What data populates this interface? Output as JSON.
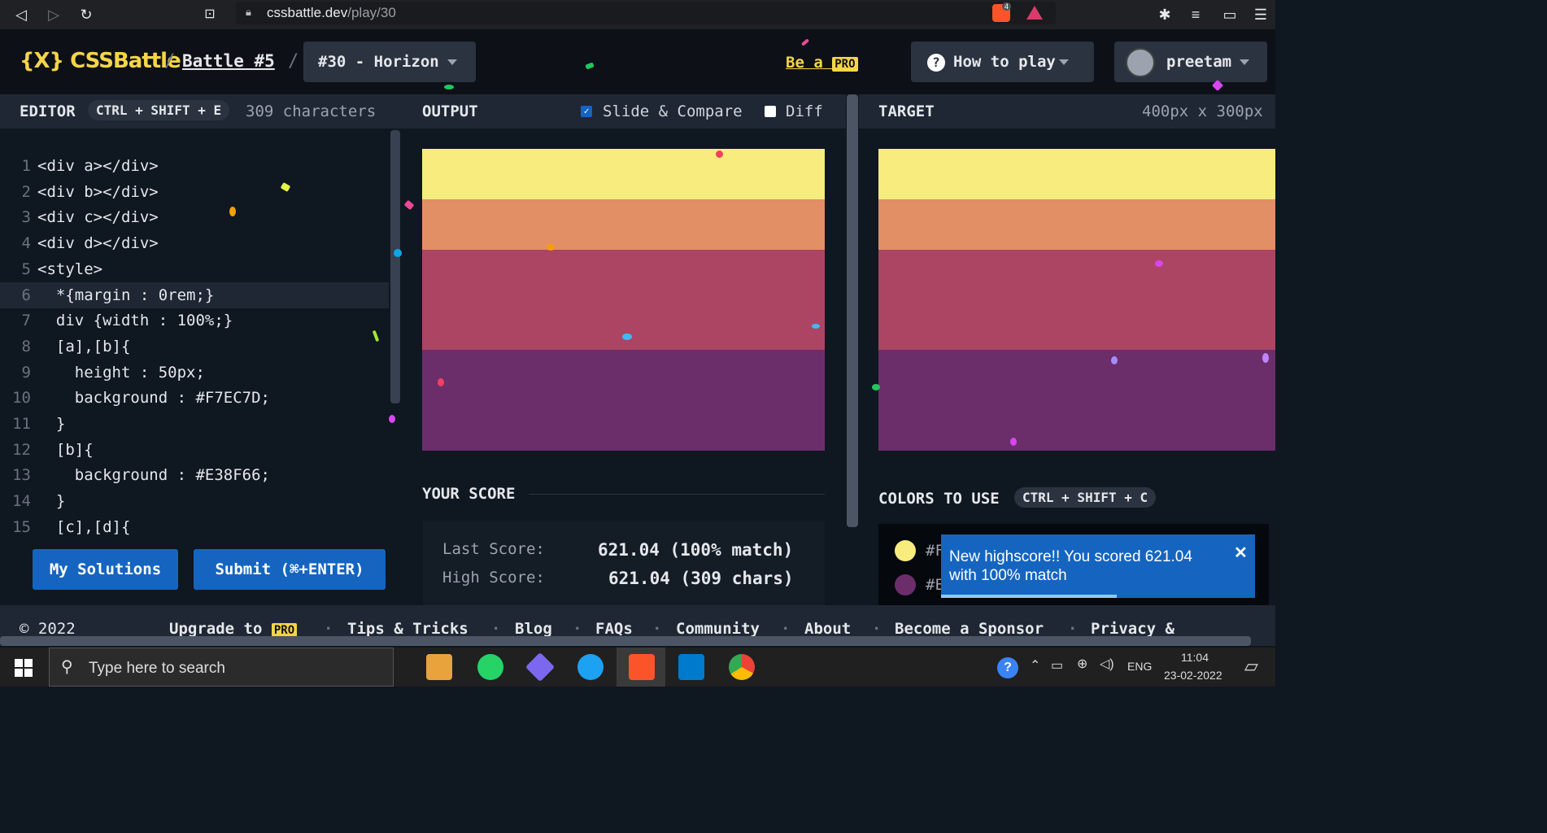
{
  "browser": {
    "url_host": "cssbattle.dev",
    "url_path": "/play/30",
    "brave_badge": "4"
  },
  "header": {
    "logo": "{X} CSSBattle",
    "battle": "Battle #5",
    "challenge": "#30 - Horizon",
    "be_a": "Be a",
    "pro": "PRO",
    "how_to_play": "How to play",
    "user": "preetam"
  },
  "editor": {
    "title": "EDITOR",
    "shortcut": "CTRL + SHIFT + E",
    "char_count": "309 characters",
    "lines": [
      {
        "n": "1",
        "text": "<div a></div>"
      },
      {
        "n": "2",
        "text": "<div b></div>"
      },
      {
        "n": "3",
        "text": "<div c></div>"
      },
      {
        "n": "4",
        "text": "<div d></div>"
      },
      {
        "n": "5",
        "text": "<style>"
      },
      {
        "n": "6",
        "text": "  *{margin : 0rem;}"
      },
      {
        "n": "7",
        "text": "  div {width : 100%;}"
      },
      {
        "n": "8",
        "text": "  [a],[b]{"
      },
      {
        "n": "9",
        "text": "    height : 50px;"
      },
      {
        "n": "10",
        "text": "    background : #F7EC7D;"
      },
      {
        "n": "11",
        "text": "  }"
      },
      {
        "n": "12",
        "text": "  [b]{"
      },
      {
        "n": "13",
        "text": "    background : #E38F66;"
      },
      {
        "n": "14",
        "text": "  }"
      },
      {
        "n": "15",
        "text": "  [c],[d]{"
      }
    ],
    "my_solutions": "My Solutions",
    "submit": "Submit (⌘+ENTER)"
  },
  "output": {
    "title": "OUTPUT",
    "slide_compare": "Slide & Compare",
    "diff": "Diff",
    "your_score": "YOUR SCORE",
    "last_score_label": "Last Score:",
    "last_score_value": "621.04 (100% match)",
    "high_score_label": "High Score:",
    "high_score_value": "621.04 (309 chars)"
  },
  "target": {
    "title": "TARGET",
    "size": "400px x 300px",
    "colors_to_use": "COLORS TO USE",
    "colors_shortcut": "CTRL + SHIFT + C",
    "color_labels": [
      "#F",
      "#E"
    ]
  },
  "colors": {
    "band1": "#F7EC7D",
    "band2": "#E38F66",
    "band3": "#AB4563",
    "band4": "#6B2E6B",
    "swatch1": "#F7EC7D",
    "swatch2": "#6B2E6B"
  },
  "toast": {
    "message": "New highscore!! You scored 621.04 with 100% match",
    "close": "✕",
    "progress": 0.56
  },
  "footer": {
    "copyright": "© 2022",
    "upgrade": "Upgrade to",
    "pro": "PRO",
    "links": [
      "Tips & Tricks",
      "Blog",
      "FAQs",
      "Community",
      "About",
      "Become a Sponsor",
      "Privacy &"
    ]
  },
  "taskbar": {
    "search_placeholder": "Type here to search",
    "lang": "ENG",
    "time": "11:04",
    "date": "23-02-2022"
  }
}
